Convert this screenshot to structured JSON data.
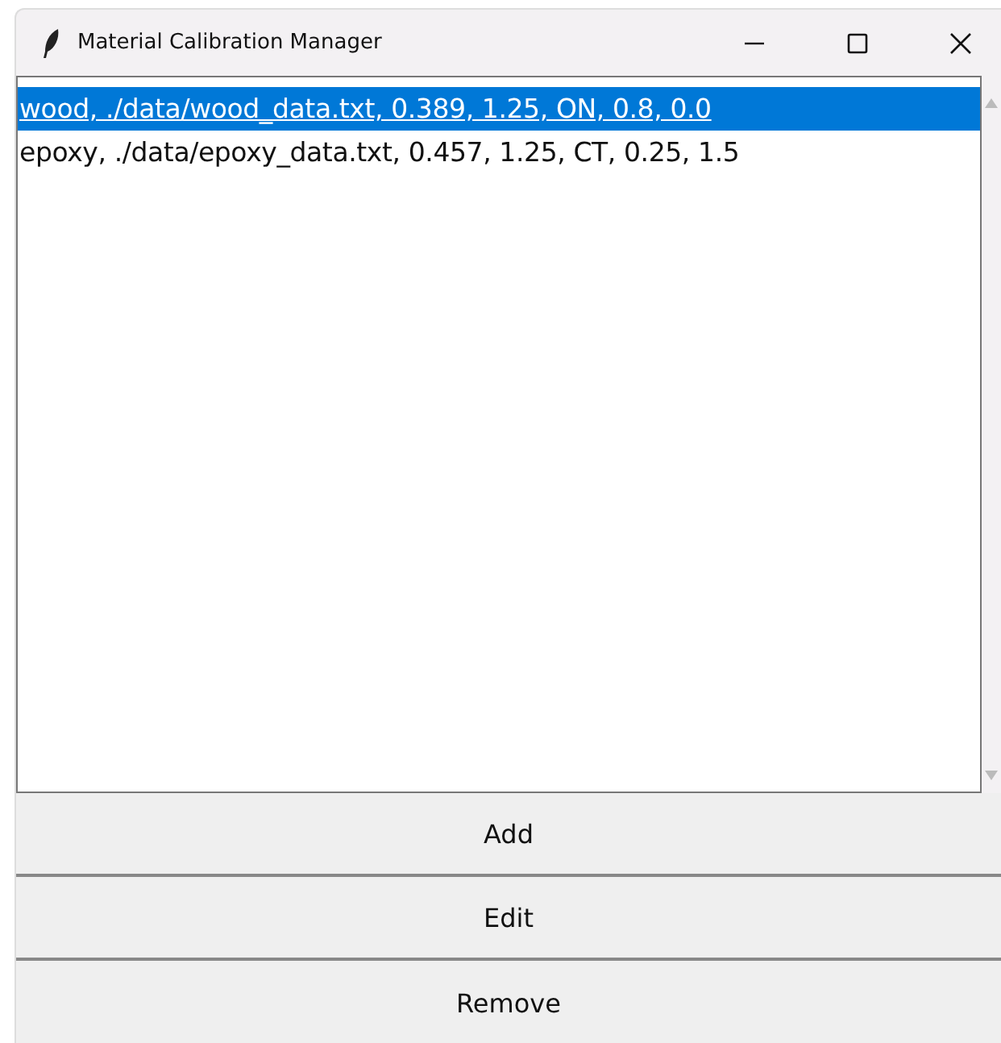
{
  "window": {
    "title": "Material Calibration Manager"
  },
  "listbox": {
    "items": [
      {
        "text": "wood, ./data/wood_data.txt, 0.389, 1.25, ON, 0.8, 0.0",
        "selected": true
      },
      {
        "text": "epoxy, ./data/epoxy_data.txt, 0.457, 1.25, CT, 0.25, 1.5",
        "selected": false
      }
    ]
  },
  "buttons": [
    "Add",
    "Edit",
    "Remove"
  ]
}
